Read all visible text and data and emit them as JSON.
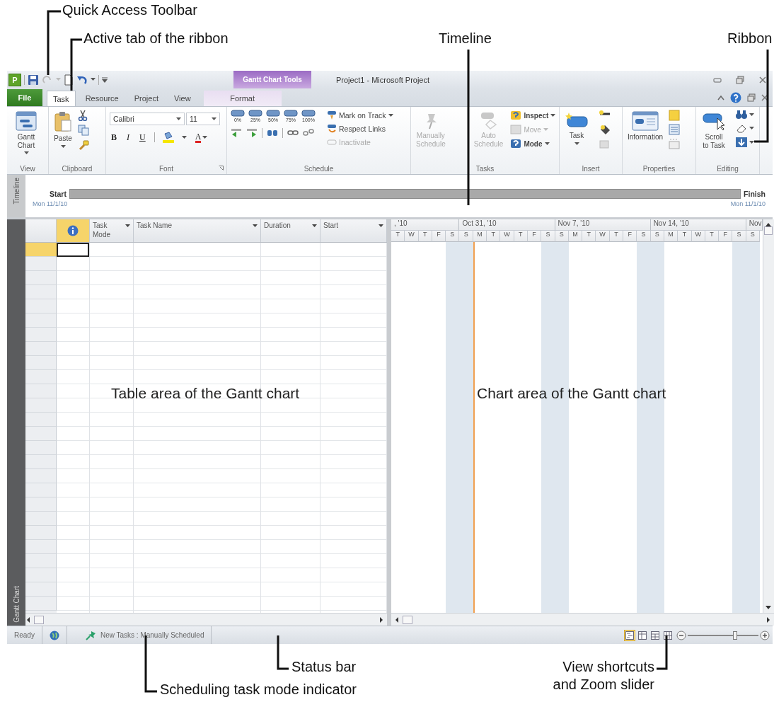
{
  "callouts": [
    {
      "text": "Quick Access Toolbar"
    },
    {
      "text": "Active tab of the ribbon"
    },
    {
      "text": "Timeline"
    },
    {
      "text": "Ribbon"
    },
    {
      "text": "Table area of the Gantt chart"
    },
    {
      "text": "Chart area of the Gantt chart"
    },
    {
      "text": "Status bar"
    },
    {
      "text": "Scheduling task mode indicator"
    },
    {
      "text": "View shortcuts and Zoom slider"
    }
  ],
  "window": {
    "app_letter": "P",
    "contextual_group": "Gantt Chart Tools",
    "title": "Project1 - Microsoft Project"
  },
  "tabs": [
    {
      "label": "File",
      "kind": "file",
      "selected": false
    },
    {
      "label": "Task",
      "kind": "tab",
      "selected": true
    },
    {
      "label": "Resource",
      "kind": "tab",
      "selected": false
    },
    {
      "label": "Project",
      "kind": "tab",
      "selected": false
    },
    {
      "label": "View",
      "kind": "tab",
      "selected": false
    },
    {
      "label": "Format",
      "kind": "contextual",
      "selected": false
    }
  ],
  "ribbon": {
    "view": {
      "label": "View",
      "gantt_chart": "Gantt Chart"
    },
    "clipboard": {
      "label": "Clipboard",
      "paste": "Paste"
    },
    "font": {
      "label": "Font",
      "font_name": "Calibri",
      "font_size": "11",
      "bold": "B",
      "italic": "I",
      "underline": "U",
      "font_color": "A"
    },
    "schedule": {
      "label": "Schedule",
      "percent_buttons": [
        "0%",
        "25%",
        "50%",
        "75%",
        "100%"
      ],
      "commands": [
        {
          "label": "Mark on Track",
          "disabled": false
        },
        {
          "label": "Respect Links",
          "disabled": false
        },
        {
          "label": "Inactivate",
          "disabled": true
        }
      ]
    },
    "tasks": {
      "label": "Tasks",
      "big_buttons": [
        {
          "label": "Manually Schedule",
          "disabled": true
        },
        {
          "label": "Auto Schedule",
          "disabled": true
        }
      ],
      "commands": [
        {
          "label": "Inspect",
          "disabled": false
        },
        {
          "label": "Move",
          "disabled": true
        },
        {
          "label": "Mode",
          "disabled": false
        }
      ]
    },
    "insert": {
      "label": "Insert",
      "task": "Task"
    },
    "properties": {
      "label": "Properties",
      "information": "Information"
    },
    "editing": {
      "label": "Editing",
      "scroll_to_task": "Scroll to Task"
    }
  },
  "timeline": {
    "side_label": "Timeline",
    "start": "Start",
    "finish": "Finish",
    "start_date": "Mon 11/1/10",
    "finish_date": "Mon 11/1/10"
  },
  "gantt": {
    "side_label": "Gantt Chart",
    "columns": [
      {
        "label": "Task Mode"
      },
      {
        "label": "Task Name"
      },
      {
        "label": "Duration"
      },
      {
        "label": "Start"
      }
    ],
    "weeks": [
      {
        "label": ", '10",
        "days": [
          {
            "d": "T",
            "weekend": false,
            "today": false
          },
          {
            "d": "W",
            "weekend": false,
            "today": false
          },
          {
            "d": "T",
            "weekend": false,
            "today": false
          },
          {
            "d": "F",
            "weekend": false,
            "today": false
          },
          {
            "d": "S",
            "weekend": true,
            "today": false
          }
        ]
      },
      {
        "label": "Oct 31, '10",
        "days": [
          {
            "d": "S",
            "weekend": true,
            "today": false
          },
          {
            "d": "M",
            "weekend": false,
            "today": true
          },
          {
            "d": "T",
            "weekend": false,
            "today": false
          },
          {
            "d": "W",
            "weekend": false,
            "today": false
          },
          {
            "d": "T",
            "weekend": false,
            "today": false
          },
          {
            "d": "F",
            "weekend": false,
            "today": false
          },
          {
            "d": "S",
            "weekend": true,
            "today": false
          }
        ]
      },
      {
        "label": "Nov 7, '10",
        "days": [
          {
            "d": "S",
            "weekend": true,
            "today": false
          },
          {
            "d": "M",
            "weekend": false,
            "today": false
          },
          {
            "d": "T",
            "weekend": false,
            "today": false
          },
          {
            "d": "W",
            "weekend": false,
            "today": false
          },
          {
            "d": "T",
            "weekend": false,
            "today": false
          },
          {
            "d": "F",
            "weekend": false,
            "today": false
          },
          {
            "d": "S",
            "weekend": true,
            "today": false
          }
        ]
      },
      {
        "label": "Nov 14, '10",
        "days": [
          {
            "d": "S",
            "weekend": true,
            "today": false
          },
          {
            "d": "M",
            "weekend": false,
            "today": false
          },
          {
            "d": "T",
            "weekend": false,
            "today": false
          },
          {
            "d": "W",
            "weekend": false,
            "today": false
          },
          {
            "d": "T",
            "weekend": false,
            "today": false
          },
          {
            "d": "F",
            "weekend": false,
            "today": false
          },
          {
            "d": "S",
            "weekend": true,
            "today": false
          }
        ]
      },
      {
        "label": "Nov",
        "days": [
          {
            "d": "S",
            "weekend": true,
            "today": false
          }
        ]
      }
    ]
  },
  "status_bar": {
    "ready": "Ready",
    "task_mode": "New Tasks : Manually Scheduled",
    "view_shortcuts": [
      {
        "selected": true
      },
      {
        "selected": false
      },
      {
        "selected": false
      },
      {
        "selected": false
      }
    ],
    "zoom": {
      "level": 0.67
    }
  }
}
